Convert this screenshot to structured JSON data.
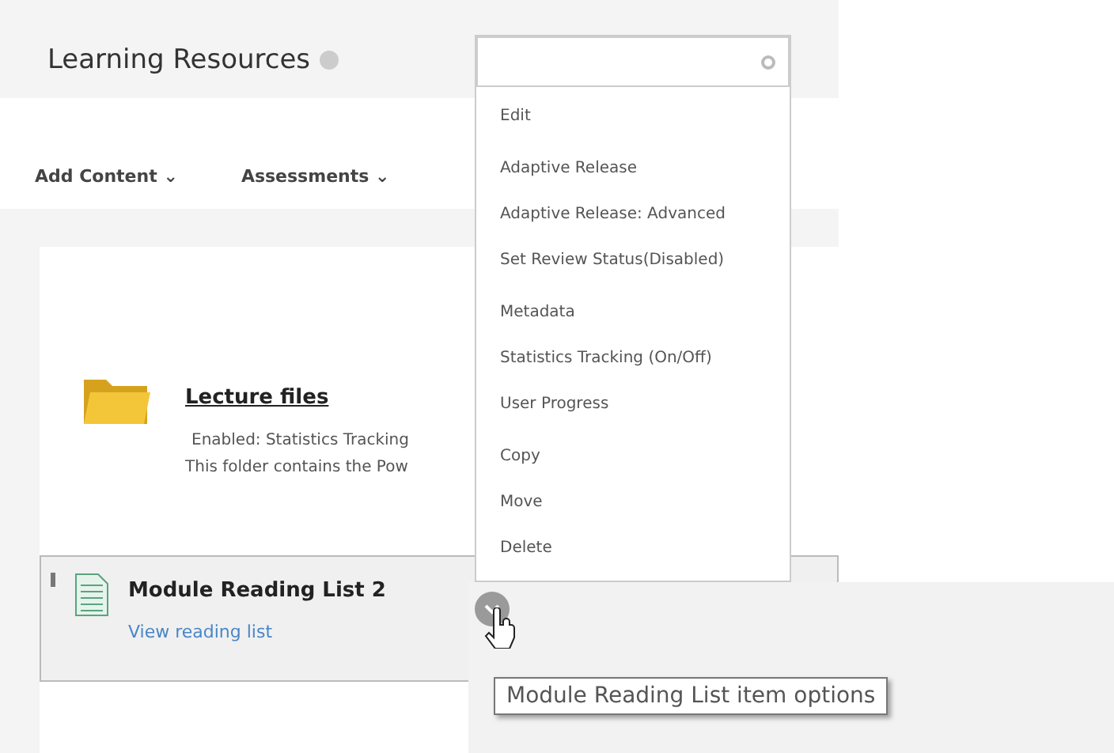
{
  "page": {
    "title": "Learning Resources"
  },
  "toolbar": [
    {
      "label": "Add Content",
      "caret": "⌄"
    },
    {
      "label": "Assessments",
      "caret": "⌄"
    }
  ],
  "items": [
    {
      "kind": "folder",
      "title": "Lecture files",
      "status": "Enabled:  Statistics Tracking",
      "description": "This folder contains the Pow"
    },
    {
      "kind": "document",
      "title": "Module Reading List 2",
      "link": "View reading list"
    }
  ],
  "menu": {
    "groups": [
      [
        "Edit"
      ],
      [
        "Adaptive Release",
        "Adaptive Release: Advanced",
        "Set Review Status(Disabled)"
      ],
      [
        "Metadata",
        "Statistics Tracking (On/Off)",
        "User Progress"
      ],
      [
        "Copy",
        "Move",
        "Delete"
      ]
    ]
  },
  "tooltip": "Module Reading List item options"
}
